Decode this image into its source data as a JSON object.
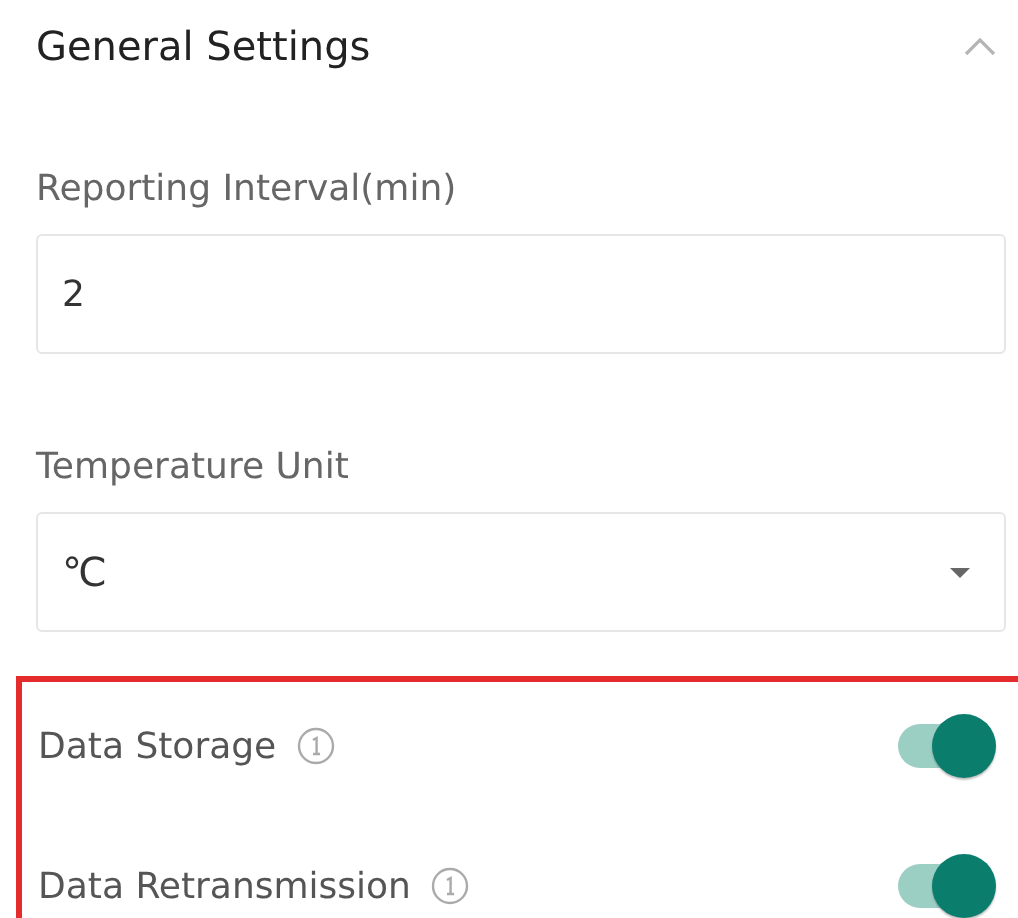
{
  "section": {
    "title": "General Settings",
    "expanded": true
  },
  "fields": [
    {
      "kind": "input",
      "label": "Reporting Interval(min)",
      "value": "2"
    },
    {
      "kind": "select",
      "label": "Temperature Unit",
      "value": "℃"
    }
  ],
  "highlighted_group": {
    "toggles": [
      {
        "label": "Data Storage",
        "on": true
      },
      {
        "label": "Data Retransmission",
        "on": true
      }
    ]
  }
}
